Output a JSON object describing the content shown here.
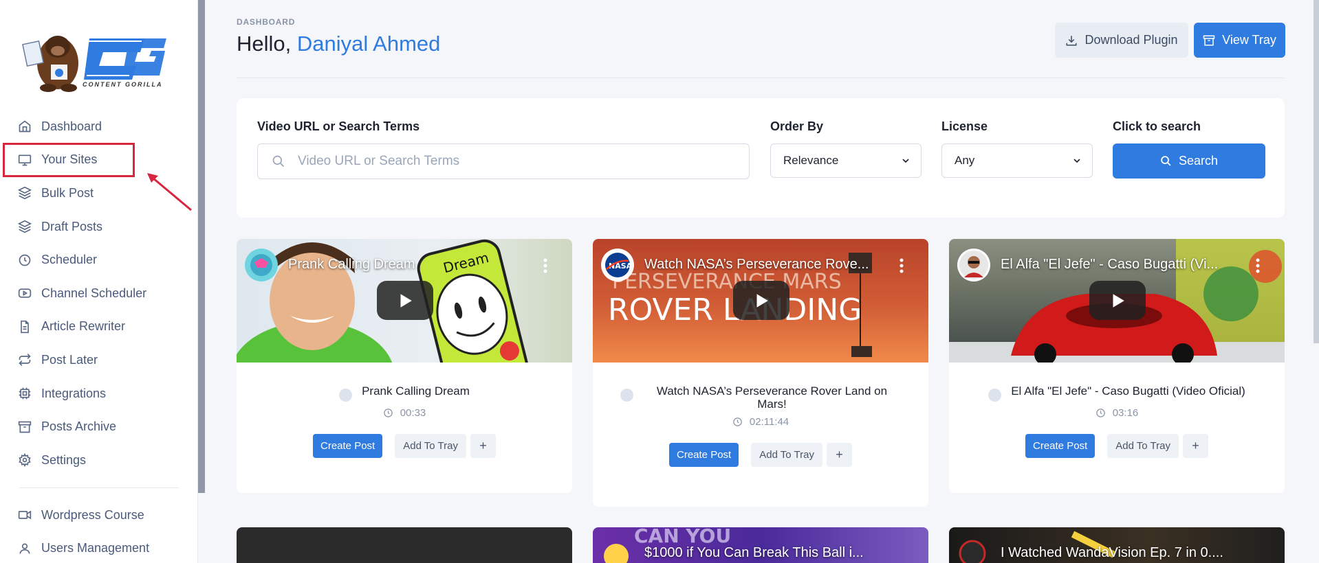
{
  "brand": {
    "logo_text": "CG",
    "logo_caption": "CONTENT GORILLA"
  },
  "sidebar": {
    "items": [
      {
        "label": "Dashboard",
        "icon": "home-icon"
      },
      {
        "label": "Your Sites",
        "icon": "monitor-icon"
      },
      {
        "label": "Bulk Post",
        "icon": "layers-icon"
      },
      {
        "label": "Draft Posts",
        "icon": "layers-icon"
      },
      {
        "label": "Scheduler",
        "icon": "clock-icon"
      },
      {
        "label": "Channel Scheduler",
        "icon": "youtube-icon"
      },
      {
        "label": "Article Rewriter",
        "icon": "file-text-icon"
      },
      {
        "label": "Post Later",
        "icon": "repeat-icon"
      },
      {
        "label": "Integrations",
        "icon": "cpu-icon"
      },
      {
        "label": "Posts Archive",
        "icon": "archive-icon"
      },
      {
        "label": "Settings",
        "icon": "gear-icon"
      }
    ],
    "secondary": [
      {
        "label": "Wordpress Course",
        "icon": "video-icon"
      },
      {
        "label": "Users Management",
        "icon": "user-icon"
      }
    ]
  },
  "header": {
    "breadcrumb": "DASHBOARD",
    "greeting": "Hello,",
    "user_name": "Daniyal Ahmed",
    "download_label": "Download Plugin",
    "tray_label": "View Tray"
  },
  "search": {
    "url_label": "Video URL or Search Terms",
    "url_placeholder": "Video URL or Search Terms",
    "order_label": "Order By",
    "order_value": "Relevance",
    "license_label": "License",
    "license_value": "Any",
    "click_label": "Click to search",
    "search_button": "Search"
  },
  "videos": [
    {
      "thumb_title": "Prank Calling Dream",
      "title": "Prank Calling Dream",
      "duration": "00:33",
      "create": "Create Post",
      "add": "Add To Tray",
      "plus": "+"
    },
    {
      "thumb_title": "Watch NASA’s Perseverance Rove...",
      "title": "Watch NASA’s Perseverance Rover Land on Mars!",
      "duration": "02:11:44",
      "create": "Create Post",
      "add": "Add To Tray",
      "plus": "+"
    },
    {
      "thumb_title": "El Alfa \"El Jefe\" - Caso Bugatti (Vi...",
      "title": "El Alfa \"El Jefe\" - Caso Bugatti (Video Oficial)",
      "duration": "03:16",
      "create": "Create Post",
      "add": "Add To Tray",
      "plus": "+"
    }
  ],
  "videos_next": [
    {
      "thumb_title": ""
    },
    {
      "thumb_title": "$1000 if You Can Break This Ball i..."
    },
    {
      "thumb_title": "I Watched WandaVision Ep. 7 in 0...."
    }
  ],
  "thumb_texts": {
    "dream": "Dream",
    "nasa_line1": "PERSEVERANCE MARS",
    "nasa_line2": "ROVER LANDING",
    "nasa_badge": "NASA",
    "can_you": "CAN YOU"
  },
  "colors": {
    "accent": "#2f7be0",
    "annotation": "#d7263d"
  }
}
